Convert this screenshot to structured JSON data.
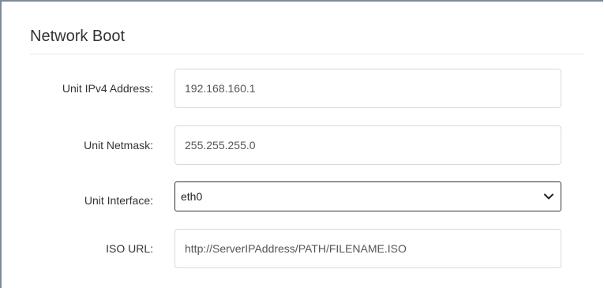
{
  "section": {
    "title": "Network Boot"
  },
  "fields": {
    "ipv4": {
      "label": "Unit IPv4 Address:",
      "value": "192.168.160.1"
    },
    "netmask": {
      "label": "Unit Netmask:",
      "value": "255.255.255.0"
    },
    "interface": {
      "label": "Unit Interface:",
      "value": "eth0",
      "icon": "chevron-down-icon"
    },
    "iso_url": {
      "label": "ISO URL:",
      "value": "http://ServerIPAddress/PATH/FILENAME.ISO"
    }
  }
}
